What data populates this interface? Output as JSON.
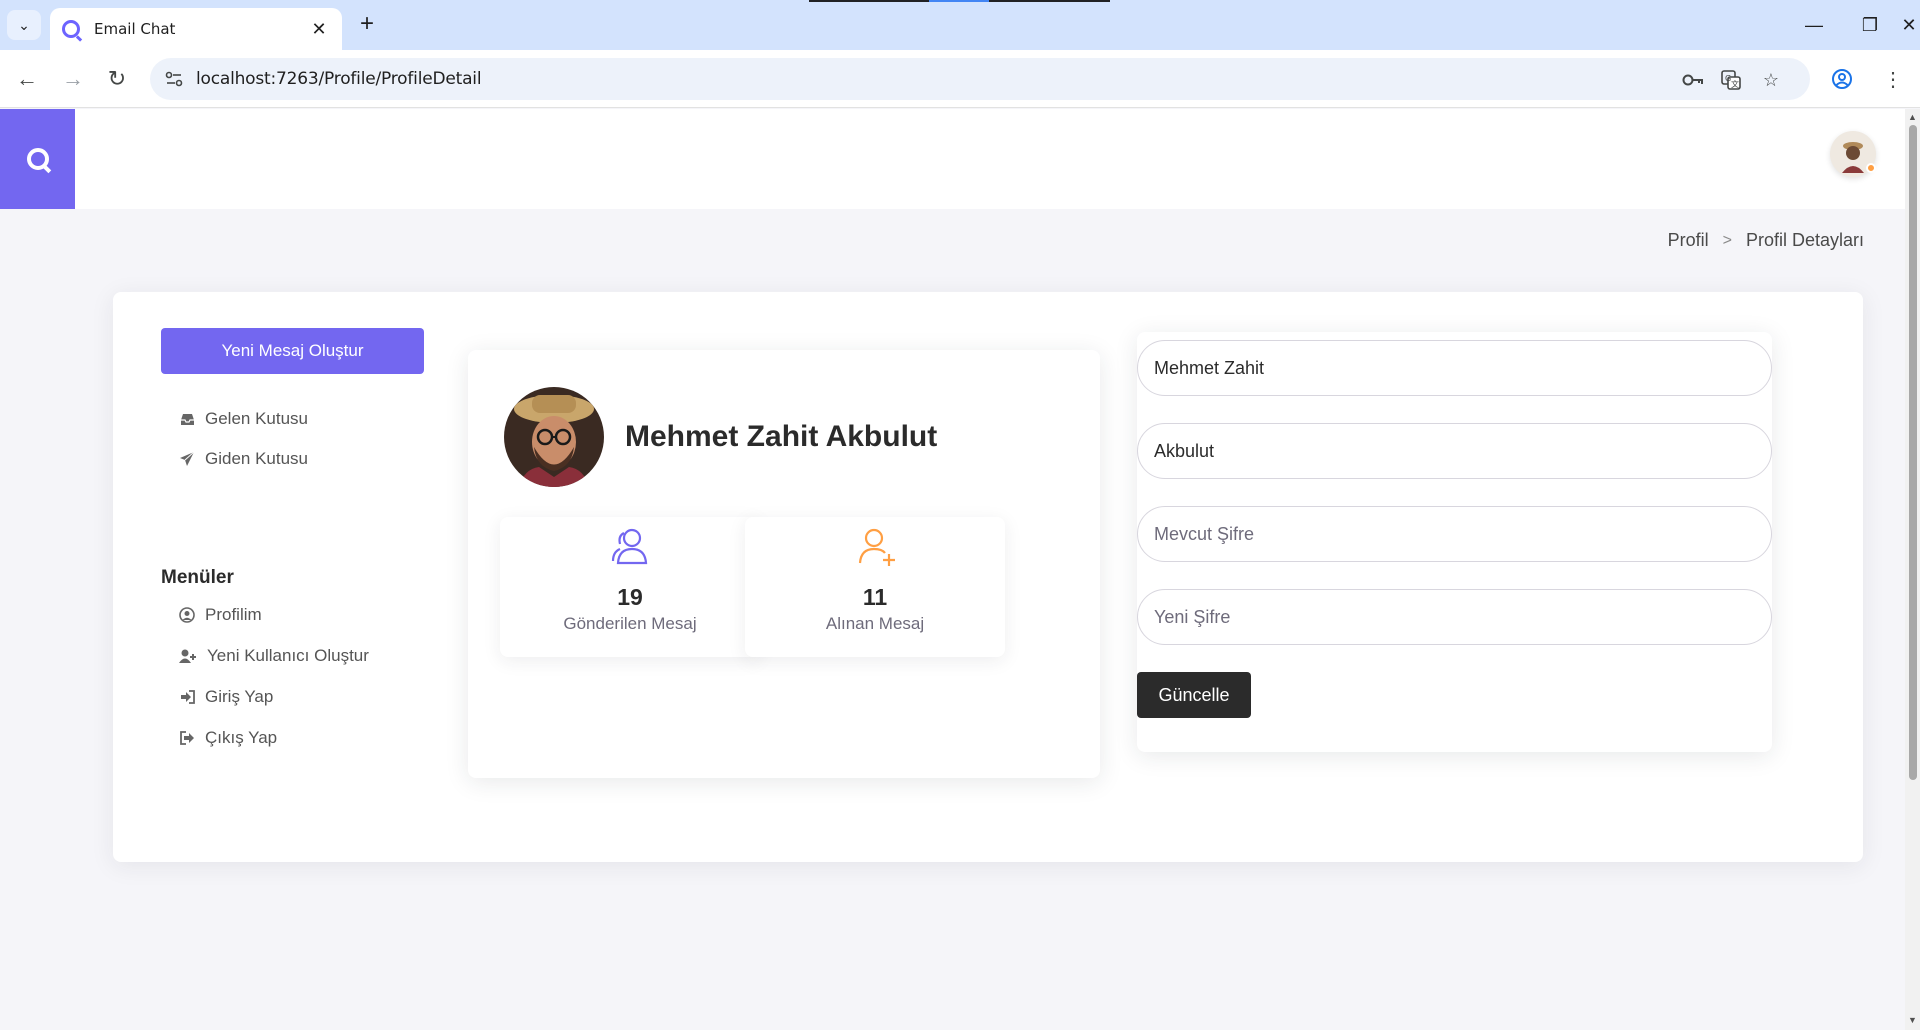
{
  "browser": {
    "tab_title": "Email Chat",
    "url": "localhost:7263/Profile/ProfileDetail"
  },
  "breadcrumb": {
    "parent": "Profil",
    "separator": ">",
    "current": "Profil Detayları"
  },
  "sidebar": {
    "compose_label": "Yeni Mesaj Oluştur",
    "mail_items": [
      {
        "label": "Gelen Kutusu",
        "icon": "inbox-icon"
      },
      {
        "label": "Giden Kutusu",
        "icon": "paper-plane-icon"
      }
    ],
    "menu_heading": "Menüler",
    "menu_items": [
      {
        "label": "Profilim",
        "icon": "user-circle-icon"
      },
      {
        "label": "Yeni Kullanıcı Oluştur",
        "icon": "user-plus-icon"
      },
      {
        "label": "Giriş Yap",
        "icon": "sign-in-icon"
      },
      {
        "label": "Çıkış Yap",
        "icon": "sign-out-icon"
      }
    ]
  },
  "profile": {
    "full_name": "Mehmet Zahit Akbulut",
    "stats": [
      {
        "value": "19",
        "label": "Gönderilen Mesaj",
        "icon": "users-icon",
        "color": "#7367f0"
      },
      {
        "value": "11",
        "label": "Alınan Mesaj",
        "icon": "user-add-icon",
        "color": "#ff9f43"
      }
    ]
  },
  "form": {
    "first_name": "Mehmet Zahit",
    "last_name": "Akbulut",
    "current_password_placeholder": "Mevcut Şifre",
    "new_password_placeholder": "Yeni Şifre",
    "submit_label": "Güncelle"
  },
  "colors": {
    "primary": "#7367f0",
    "warning": "#ff9f43",
    "dark_button": "#2b2b2b"
  }
}
